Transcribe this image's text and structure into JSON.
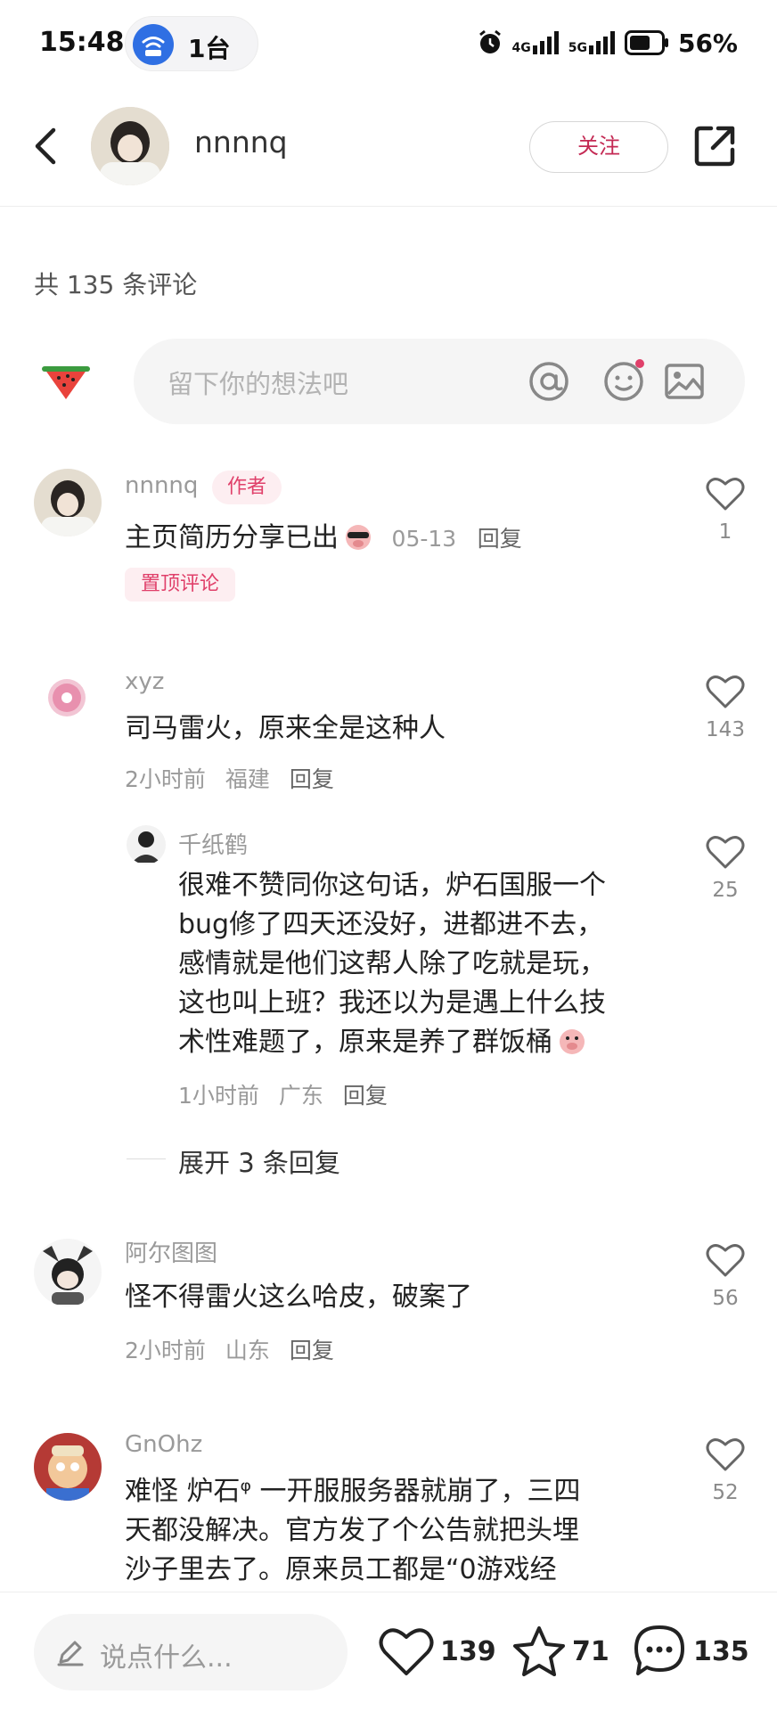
{
  "status_bar": {
    "time": "15:48",
    "hotspot_count": "1台",
    "network_1": "4G",
    "network_2": "5G",
    "battery": "56%"
  },
  "header": {
    "author_name": "nnnnq",
    "follow_label": "关注"
  },
  "comments_header": {
    "total": "共 135 条评论"
  },
  "composer": {
    "placeholder": "留下你的想法吧"
  },
  "comments": [
    {
      "name": "nnnnq",
      "author_tag": "作者",
      "text": "主页简历分享已出",
      "time": "05-13",
      "reply": "回复",
      "pin_tag": "置顶评论",
      "likes": "1"
    },
    {
      "name": "xyz",
      "text": "司马雷火，原来全是这种人",
      "time": "2小时前",
      "location": "福建",
      "reply": "回复",
      "likes": "143"
    },
    {
      "name": "千纸鹤",
      "text_lines": [
        "很难不赞同你这句话，炉石国服一个",
        "bug修了四天还没好，进都进不去，",
        "感情就是他们这帮人除了吃就是玩，",
        "这也叫上班？我还以为是遇上什么技",
        "术性难题了，原来是养了群饭桶"
      ],
      "time": "1小时前",
      "location": "广东",
      "reply": "回复",
      "likes": "25"
    },
    {
      "name": "阿尔图图",
      "text": "怪不得雷火这么哈皮，破案了",
      "time": "2小时前",
      "location": "山东",
      "reply": "回复",
      "likes": "56"
    },
    {
      "name": "GnOhz",
      "text_lines": [
        "难怪 炉石ᵠ 一开服服务器就崩了，三四",
        "天都没解决。官方发了个公告就把头埋",
        "沙子里去了。原来员工都是“0游戏经"
      ],
      "likes": "52"
    }
  ],
  "expand_replies": "展开 3 条回复",
  "bottom_bar": {
    "placeholder": "说点什么...",
    "likes": "139",
    "favorites": "71",
    "comments": "135"
  },
  "colors": {
    "accent": "#e0406a",
    "follow_text": "#c42a54",
    "hotspot_blue": "#2f6fe3"
  }
}
